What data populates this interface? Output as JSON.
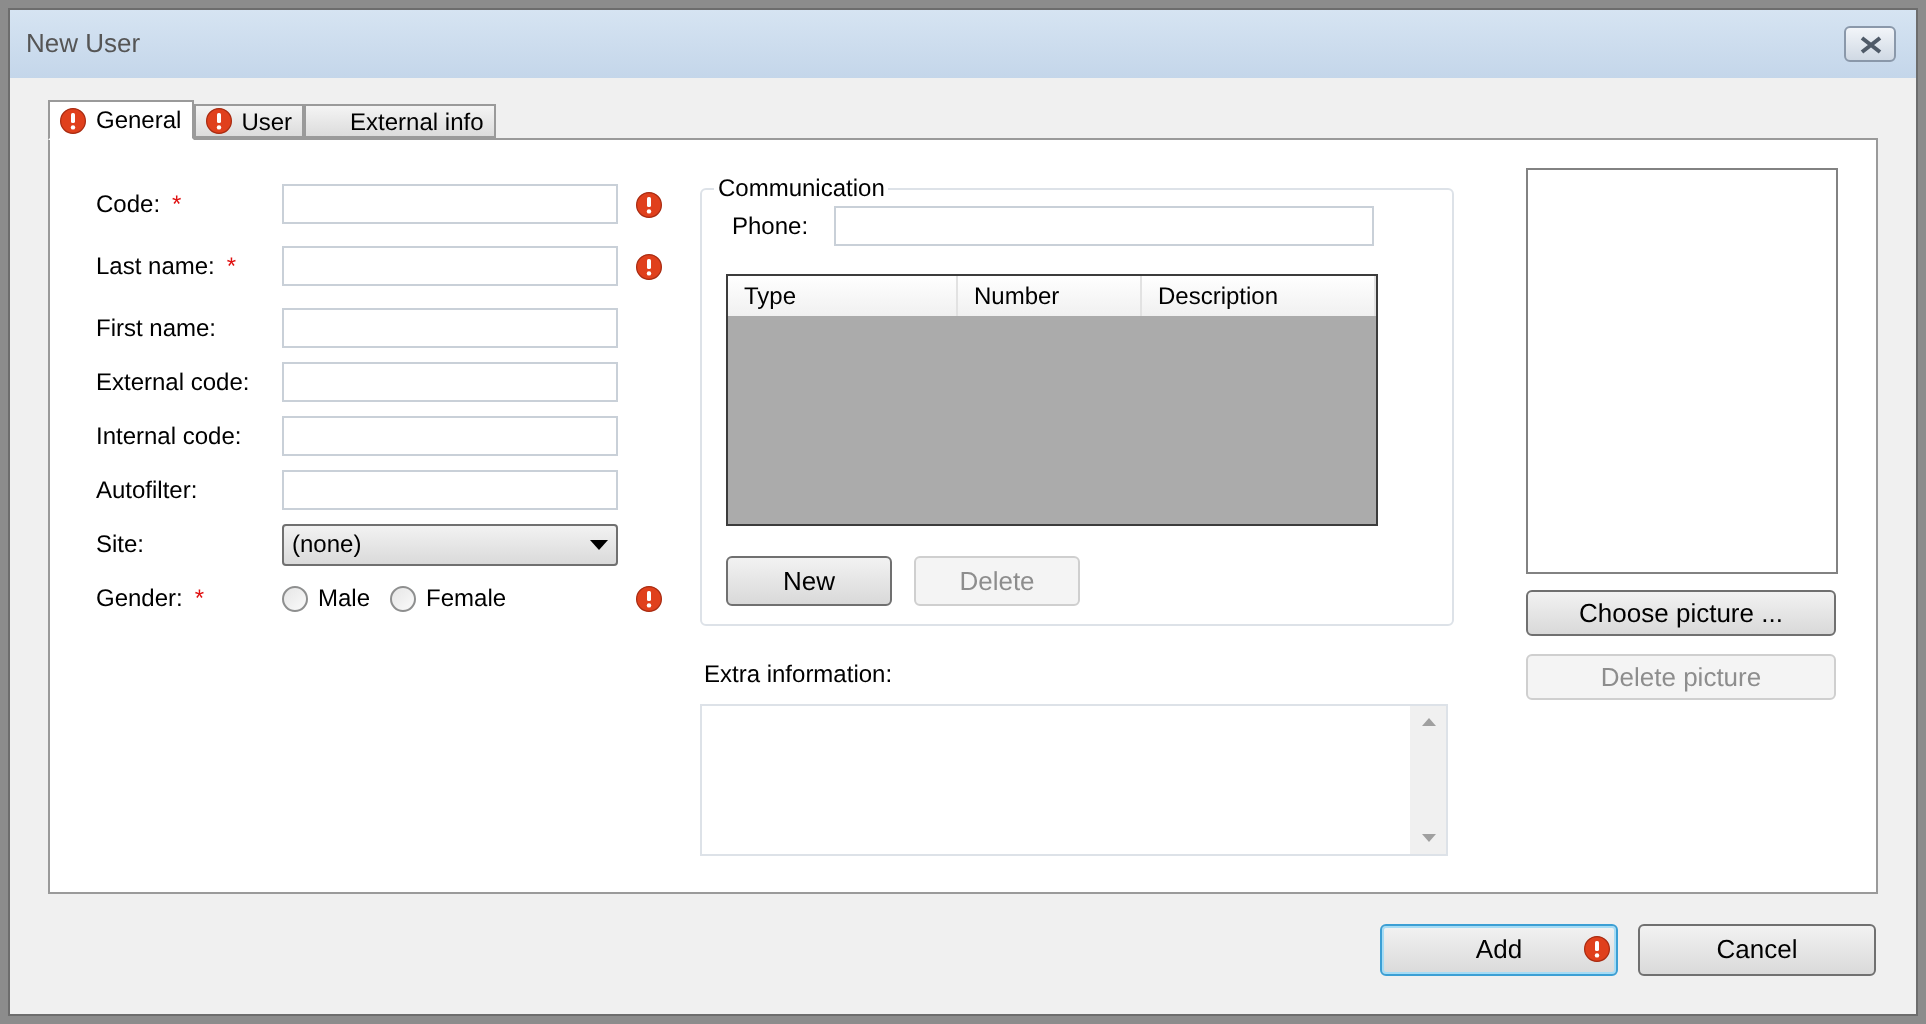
{
  "window": {
    "title": "New User"
  },
  "tabs": [
    {
      "label": "General",
      "selected": true,
      "error": true
    },
    {
      "label": "User",
      "selected": false,
      "error": true
    },
    {
      "label": "External info",
      "selected": false,
      "error": false
    }
  ],
  "fields": [
    {
      "kind": "text",
      "label": "Code:",
      "required_mark": "*",
      "error": true
    },
    {
      "kind": "text",
      "label": "Last name:",
      "required_mark": "*",
      "error": true
    },
    {
      "kind": "text",
      "label": "First name:",
      "error": false
    },
    {
      "kind": "text",
      "label": "External code:",
      "error": false
    },
    {
      "kind": "text",
      "label": "Internal code:",
      "error": false
    },
    {
      "kind": "text",
      "label": "Autofilter:",
      "error": false
    },
    {
      "kind": "select",
      "label": "Site:",
      "value": "(none)",
      "error": false
    },
    {
      "kind": "radio",
      "label": "Gender:",
      "required_mark": "*",
      "error": true,
      "options": [
        {
          "label": "Male",
          "selected": false
        },
        {
          "label": "Female",
          "selected": false
        }
      ]
    }
  ],
  "communication": {
    "title": "Communication",
    "phone_label": "Phone:",
    "table": {
      "columns": [
        "Type",
        "Number",
        "Description"
      ]
    },
    "buttons": [
      {
        "label": "New",
        "disabled": false
      },
      {
        "label": "Delete",
        "disabled": true
      }
    ]
  },
  "extra_info": {
    "label": "Extra information:"
  },
  "picture_buttons": [
    {
      "label": "Choose picture ...",
      "disabled": false
    },
    {
      "label": "Delete picture",
      "disabled": true
    }
  ],
  "footer_buttons": [
    {
      "label": "Add",
      "default": true,
      "error": true
    },
    {
      "label": "Cancel",
      "default": false,
      "error": false
    }
  ]
}
